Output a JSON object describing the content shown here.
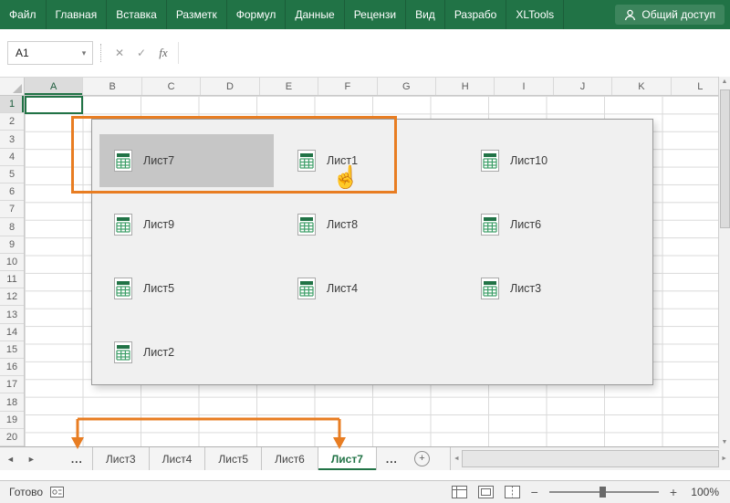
{
  "colors": {
    "ribbon_green": "#217346",
    "accent_orange": "#e87d22",
    "selected_gray": "#c6c6c6"
  },
  "ribbon": {
    "tabs": [
      {
        "label": "Файл"
      },
      {
        "label": "Главная"
      },
      {
        "label": "Вставка"
      },
      {
        "label": "Разметк"
      },
      {
        "label": "Формул"
      },
      {
        "label": "Данные"
      },
      {
        "label": "Рецензи"
      },
      {
        "label": "Вид"
      },
      {
        "label": "Разрабо"
      },
      {
        "label": "XLTools"
      }
    ],
    "share_label": "Общий доступ"
  },
  "formula_bar": {
    "name_box_value": "A1",
    "cancel_glyph": "✕",
    "enter_glyph": "✓",
    "fx_label": "fx"
  },
  "grid": {
    "selected_cell": "A1",
    "columns": [
      "A",
      "B",
      "C",
      "D",
      "E",
      "F",
      "G",
      "H",
      "I",
      "J",
      "K",
      "L"
    ],
    "rows": [
      "1",
      "2",
      "3",
      "4",
      "5",
      "6",
      "7",
      "8",
      "9",
      "10",
      "11",
      "12",
      "13",
      "14",
      "15",
      "16",
      "17",
      "18",
      "19",
      "20"
    ]
  },
  "sheet_popup": {
    "items": [
      {
        "label": "Лист7",
        "selected": true
      },
      {
        "label": "Лист1",
        "selected": false
      },
      {
        "label": "Лист10",
        "selected": false
      },
      {
        "label": "Лист9",
        "selected": false
      },
      {
        "label": "Лист8",
        "selected": false
      },
      {
        "label": "Лист6",
        "selected": false
      },
      {
        "label": "Лист5",
        "selected": false
      },
      {
        "label": "Лист4",
        "selected": false
      },
      {
        "label": "Лист3",
        "selected": false
      },
      {
        "label": "Лист2",
        "selected": false
      }
    ]
  },
  "sheet_bar": {
    "left_ellipsis": "...",
    "tabs": [
      {
        "label": "Лист3",
        "active": false
      },
      {
        "label": "Лист4",
        "active": false
      },
      {
        "label": "Лист5",
        "active": false
      },
      {
        "label": "Лист6",
        "active": false
      },
      {
        "label": "Лист7",
        "active": true
      }
    ],
    "right_ellipsis": "...",
    "add_glyph": "+"
  },
  "status_bar": {
    "ready_label": "Готово",
    "zoom_out_glyph": "−",
    "zoom_in_glyph": "+",
    "zoom_level": "100%"
  },
  "icons": {
    "nav_left": "◄",
    "nav_right": "►",
    "scroll_left": "◄",
    "scroll_right": "►",
    "scroll_up": "▲",
    "scroll_down": "▼",
    "chevron_down": "▾",
    "hand_cursor": "☝"
  }
}
